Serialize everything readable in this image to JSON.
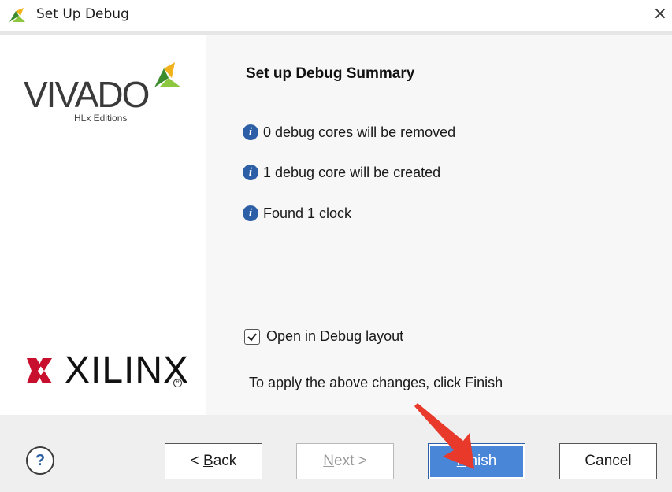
{
  "window": {
    "title": "Set Up Debug",
    "close_glyph": "×",
    "icon": "vivado-leaf-icon"
  },
  "brand": {
    "vivado_text": "VIVADO",
    "vivado_sub": "HLx Editions",
    "xilinx_text": "XILINX"
  },
  "summary": {
    "title": "Set up Debug Summary",
    "items": [
      {
        "icon": "info-icon",
        "text": "0 debug cores will be removed"
      },
      {
        "icon": "info-icon",
        "text": "1 debug core will be created"
      },
      {
        "icon": "info-icon",
        "text": "Found 1 clock"
      }
    ],
    "checkbox_label": "Open in Debug layout",
    "checkbox_checked": true,
    "apply_text": "To apply the above changes, click Finish"
  },
  "buttons": {
    "help": "?",
    "back_prefix": "< ",
    "back_mnemonic": "B",
    "back_rest": "ack",
    "next_mnemonic": "N",
    "next_rest": "ext >",
    "finish_mnemonic": "F",
    "finish_rest": "inish",
    "cancel": "Cancel"
  },
  "colors": {
    "accent": "#4a86d8",
    "info_icon": "#2d5fa6",
    "annotation_arrow": "#e8392b",
    "xilinx_red": "#c8102e",
    "vivado_green": "#8dc63f"
  }
}
